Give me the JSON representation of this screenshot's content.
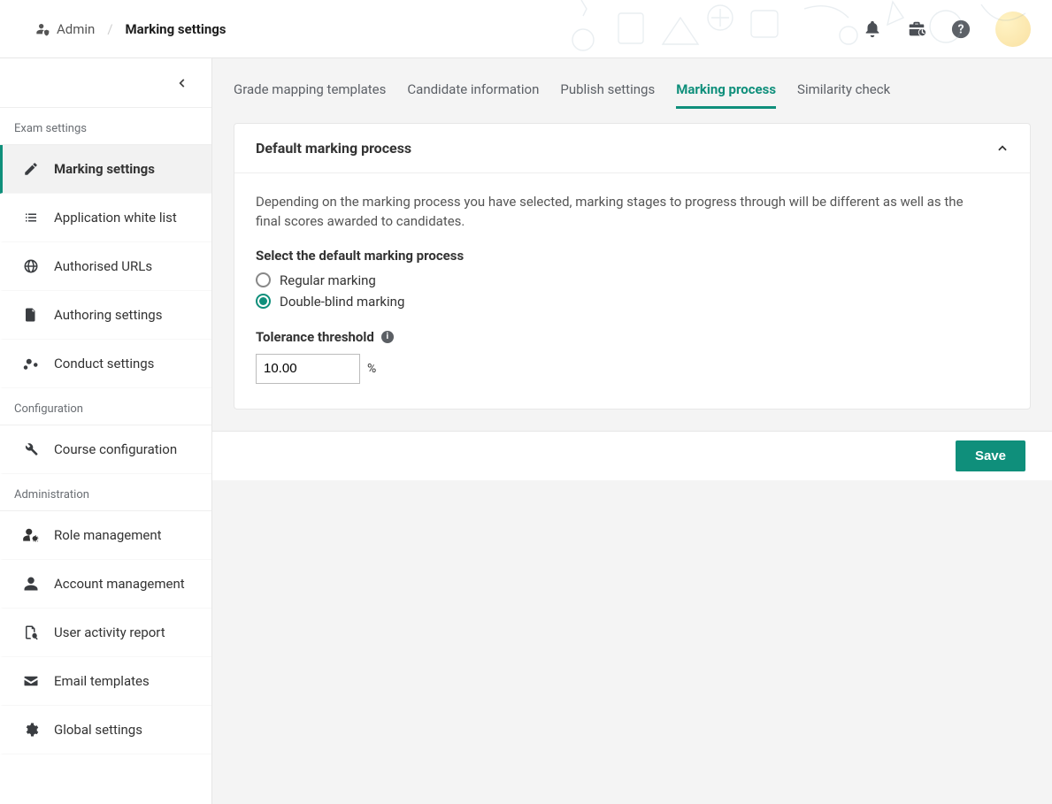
{
  "breadcrumb": {
    "root": "Admin",
    "current": "Marking settings"
  },
  "sidebar": {
    "sections": [
      {
        "header": "Exam settings",
        "items": [
          {
            "id": "marking-settings",
            "label": "Marking settings",
            "icon": "pencil",
            "active": true
          },
          {
            "id": "whitelist",
            "label": "Application white list",
            "icon": "list"
          },
          {
            "id": "auth-urls",
            "label": "Authorised URLs",
            "icon": "globe"
          },
          {
            "id": "authoring",
            "label": "Authoring settings",
            "icon": "file"
          },
          {
            "id": "conduct",
            "label": "Conduct settings",
            "icon": "cogs"
          }
        ]
      },
      {
        "header": "Configuration",
        "items": [
          {
            "id": "course-config",
            "label": "Course configuration",
            "icon": "wrench"
          }
        ]
      },
      {
        "header": "Administration",
        "items": [
          {
            "id": "roles",
            "label": "Role management",
            "icon": "users-cog"
          },
          {
            "id": "accounts",
            "label": "Account management",
            "icon": "user"
          },
          {
            "id": "activity",
            "label": "User activity report",
            "icon": "file-search"
          },
          {
            "id": "email",
            "label": "Email templates",
            "icon": "envelope"
          },
          {
            "id": "global",
            "label": "Global settings",
            "icon": "cog"
          }
        ]
      }
    ]
  },
  "tabs": [
    {
      "id": "grade-mapping",
      "label": "Grade mapping templates"
    },
    {
      "id": "candidate-info",
      "label": "Candidate information"
    },
    {
      "id": "publish",
      "label": "Publish settings"
    },
    {
      "id": "marking-process",
      "label": "Marking process",
      "active": true
    },
    {
      "id": "similarity",
      "label": "Similarity check"
    }
  ],
  "panel": {
    "title": "Default marking process",
    "description": "Depending on the marking process you have selected, marking stages to progress through will be different as well as the final scores awarded to candidates.",
    "select_label": "Select the default marking process",
    "options": [
      {
        "id": "regular",
        "label": "Regular marking",
        "selected": false
      },
      {
        "id": "double-blind",
        "label": "Double-blind marking",
        "selected": true
      }
    ],
    "tolerance_label": "Tolerance threshold",
    "tolerance_value": "10.00",
    "tolerance_unit": "%"
  },
  "footer": {
    "save_label": "Save"
  }
}
